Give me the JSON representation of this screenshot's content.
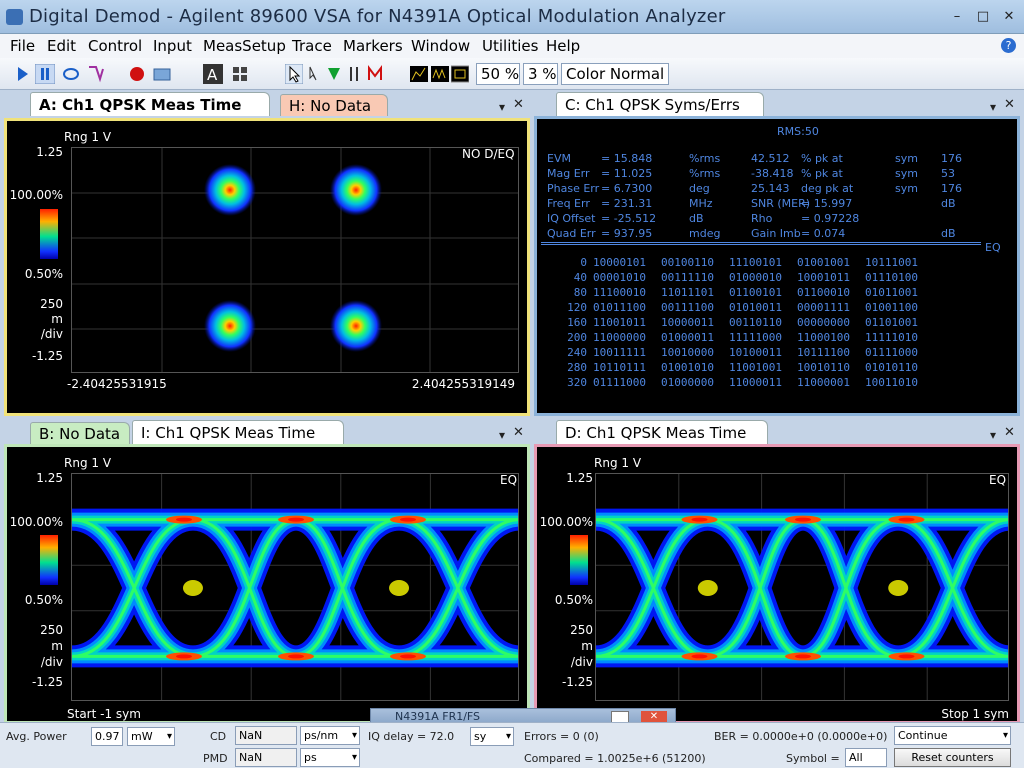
{
  "window": {
    "title": "Digital Demod - Agilent 89600 VSA for N4391A Optical Modulation Analyzer",
    "min": "–",
    "max": "□",
    "close": "✕"
  },
  "menu": [
    "File",
    "Edit",
    "Control",
    "Input",
    "MeasSetup",
    "Trace",
    "Markers",
    "Window",
    "Utilities",
    "Help"
  ],
  "toolbar": {
    "zoom1": "50 %",
    "zoom2": "3 %",
    "color_mode": "Color Normal"
  },
  "panelA": {
    "tab": "A: Ch1 QPSK Meas Time",
    "tab2": "H: No Data",
    "rng": "Rng 1  V",
    "ytop": "1.25",
    "pct_hi": "100.00%",
    "pct_lo": "0.50%",
    "div1": "250",
    "div2": "m",
    "div3": "/div",
    "ybot": "-1.25",
    "xleft": "-2.40425531915",
    "xright": "2.404255319149",
    "tag": "NO D/EQ"
  },
  "panelC": {
    "tab": "C: Ch1 QPSK Syms/Errs",
    "rms": "RMS:50",
    "eq": "EQ",
    "rows": [
      [
        "EVM",
        "= 15.848",
        "%rms",
        "42.512",
        "% pk  at",
        "sym",
        "176"
      ],
      [
        "Mag Err",
        "= 11.025",
        "%rms",
        "-38.418",
        "% pk  at",
        "sym",
        "53"
      ],
      [
        "Phase Err",
        "= 6.7300",
        "deg",
        "25.143",
        "deg  pk  at",
        "sym",
        "176"
      ],
      [
        "Freq Err",
        "= 231.31",
        "MHz",
        "SNR (MER)",
        "= 15.997",
        "",
        "dB"
      ],
      [
        "IQ Offset",
        "= -25.512",
        "dB",
        "Rho",
        "= 0.97228",
        "",
        ""
      ],
      [
        "Quad Err",
        "= 937.95",
        "mdeg",
        "Gain  Imb",
        "= 0.074",
        "",
        "dB"
      ]
    ],
    "syms": [
      [
        "0",
        "10000101",
        "00100110",
        "11100101",
        "01001001",
        "10111001"
      ],
      [
        "40",
        "00001010",
        "00111110",
        "01000010",
        "10001011",
        "01110100"
      ],
      [
        "80",
        "11100010",
        "11011101",
        "01100101",
        "01100010",
        "01011001"
      ],
      [
        "120",
        "01011100",
        "00111100",
        "01010011",
        "00001111",
        "01001100"
      ],
      [
        "160",
        "11001011",
        "10000011",
        "00110110",
        "00000000",
        "01101001"
      ],
      [
        "200",
        "11000000",
        "01000011",
        "11111000",
        "11000100",
        "11111010"
      ],
      [
        "240",
        "10011111",
        "10010000",
        "10100011",
        "10111100",
        "01111000"
      ],
      [
        "280",
        "10110111",
        "01001010",
        "11001001",
        "10010110",
        "01010110"
      ],
      [
        "320",
        "01111000",
        "01000000",
        "11000011",
        "11000001",
        "10011010"
      ]
    ]
  },
  "panelI": {
    "tab_b": "B: No Data",
    "tab": "I: Ch1 QPSK Meas Time",
    "rng": "Rng 1  V",
    "ytop": "1.25",
    "pct_hi": "100.00%",
    "pct_lo": "0.50%",
    "div1": "250",
    "div2": "m",
    "div3": "/div",
    "ybot": "-1.25",
    "xleft": "Start -1  sym",
    "tag": "EQ"
  },
  "panelD": {
    "tab": "D: Ch1 QPSK Meas Time",
    "rng": "Rng 1  V",
    "ytop": "1.25",
    "pct_hi": "100.00%",
    "pct_lo": "0.50%",
    "div1": "250",
    "div2": "m",
    "div3": "/div",
    "ybot": "-1.25",
    "xright": "Stop 1  sym",
    "tag": "EQ"
  },
  "status": {
    "avg_power_label": "Avg. Power",
    "avg_power": "0.97",
    "avg_unit": "mW",
    "cd_label": "CD",
    "cd": "NaN",
    "cd_unit": "ps/nm",
    "pmd_label": "PMD",
    "pmd": "NaN",
    "pmd_unit": "ps",
    "iq_delay": "IQ delay    =  72.0",
    "iq_unit": "sy",
    "errors": "Errors        =  0 (0)",
    "compared": "Compared    =  1.0025e+6 (51200)",
    "ber": "BER =        0.0000e+0 (0.0000e+0)",
    "symbol_label": "Symbol =",
    "symbol": "All",
    "continue": "Continue",
    "reset": "Reset counters",
    "float_title": "N4391A  FR1/FS"
  }
}
